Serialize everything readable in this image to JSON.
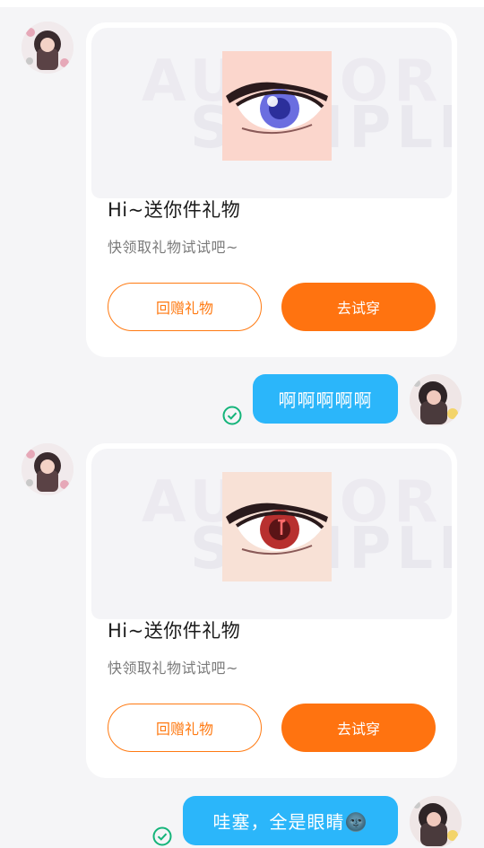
{
  "messages": [
    {
      "type": "gift_card",
      "title": "Hi~送你件礼物",
      "subtitle": "快领取礼物试试吧~",
      "watermark_top": "AUTHOR",
      "watermark_bottom": "SAMPLE",
      "iris_color": "#6b6ee0",
      "skin_color": "#fbd6cc",
      "button_secondary": "回赠礼物",
      "button_primary": "去试穿"
    },
    {
      "type": "outgoing_text",
      "text": "啊啊啊啊啊",
      "status": "sent"
    },
    {
      "type": "gift_card",
      "title": "Hi~送你件礼物",
      "subtitle": "快领取礼物试试吧~",
      "watermark_top": "AUTHOR",
      "watermark_bottom": "SAMPLE",
      "iris_color": "#b8302f",
      "skin_color": "#f8e1d6",
      "button_secondary": "回赠礼物",
      "button_primary": "去试穿"
    },
    {
      "type": "outgoing_text",
      "text": "哇塞，全是眼睛🌚",
      "status": "sent"
    }
  ],
  "colors": {
    "accent_orange": "#ff7310",
    "bubble_blue": "#2bb6fa",
    "check_green": "#14b47a"
  }
}
